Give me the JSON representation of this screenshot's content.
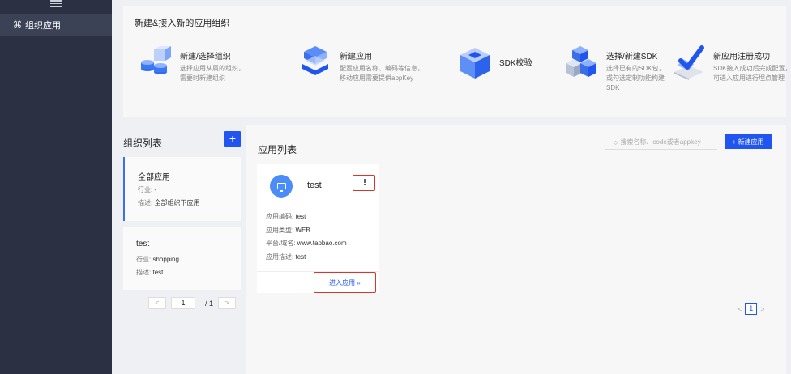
{
  "sidebar": {
    "item_icon": "⌘",
    "item_label": "组织应用"
  },
  "banner": {
    "title": "新建&接入新的应用组织",
    "steps": [
      {
        "icon": "database-cubes-icon",
        "title": "新建/选择组织",
        "desc": "选择应用从属的组织，\n需要时新建组织"
      },
      {
        "icon": "stack-box-icon",
        "title": "新建应用",
        "desc": "配置应用名称、编码等信息，\n移动应用需要提供appKey"
      },
      {
        "icon": "cube-check-icon",
        "title": "SDK校验",
        "desc": ""
      },
      {
        "icon": "cube-stack-icon",
        "title": "选择/新建SDK",
        "desc": "选择已有的SDK包，\n或勾选定制功能构建\nSDK"
      },
      {
        "icon": "check-register-icon",
        "title": "新应用注册成功",
        "desc": "SDK接入成功后完成配置，\n可进入应用进行埋点管理"
      }
    ]
  },
  "org_list": {
    "title": "组织列表",
    "add_label": "+",
    "items": [
      {
        "name": "全部应用",
        "industry_label": "行业:",
        "industry": "-",
        "desc_label": "描述:",
        "desc": "全部组织下应用"
      },
      {
        "name": "test",
        "industry_label": "行业:",
        "industry": "shopping",
        "desc_label": "描述:",
        "desc": "test"
      }
    ],
    "pager": {
      "prev": "<",
      "page": "1",
      "sep": "/",
      "total": "1",
      "next": ">"
    }
  },
  "app_list": {
    "title": "应用列表",
    "search_placeholder": "搜索名称、code或者appkey",
    "new_button": "+ 新建应用",
    "apps": [
      {
        "name": "test",
        "code_label": "应用编码:",
        "code": "test",
        "type_label": "应用类型:",
        "type": "WEB",
        "domain_label": "平台/域名:",
        "domain": "www.taobao.com",
        "desc_label": "应用描述:",
        "desc": "test",
        "enter_label": "进入应用 »"
      }
    ],
    "pager": {
      "prev": "<",
      "page": "1",
      "next": ">"
    }
  },
  "colors": {
    "primary": "#2155f0",
    "highlight": "#d9352b",
    "sidebar": "#2b3142"
  }
}
